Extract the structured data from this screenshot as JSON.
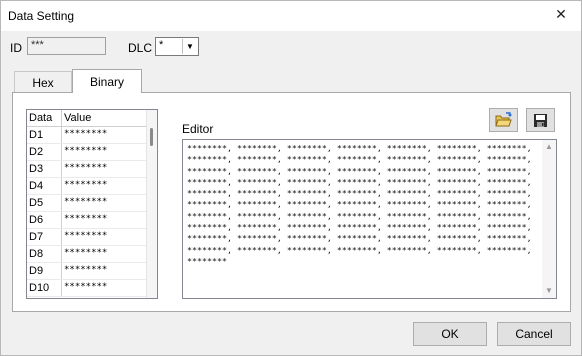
{
  "window": {
    "title": "Data Setting",
    "close_glyph": "✕"
  },
  "id_field": {
    "label": "ID",
    "value": "***"
  },
  "dlc_field": {
    "label": "DLC",
    "value": "*",
    "arrow": "▼"
  },
  "tabs": [
    {
      "label": "Hex"
    },
    {
      "label": "Binary"
    }
  ],
  "data_list": {
    "headers": [
      "Data",
      "Value"
    ],
    "rows": [
      {
        "data": "D1",
        "value": "********"
      },
      {
        "data": "D2",
        "value": "********"
      },
      {
        "data": "D3",
        "value": "********"
      },
      {
        "data": "D4",
        "value": "********"
      },
      {
        "data": "D5",
        "value": "********"
      },
      {
        "data": "D6",
        "value": "********"
      },
      {
        "data": "D7",
        "value": "********"
      },
      {
        "data": "D8",
        "value": "********"
      },
      {
        "data": "D9",
        "value": "********"
      },
      {
        "data": "D10",
        "value": "********"
      }
    ]
  },
  "editor": {
    "label": "Editor",
    "content": "********, ********, ********, ********, ********, ********, ********, ********, ********, ********, ********, ********, ********, ********, ********, ********, ********, ********, ********, ********, ********, ********, ********, ********, ********, ********, ********, ********, ********, ********, ********, ********, ********, ********, ********, ********, ********, ********, ********, ********, ********, ********, ********, ********, ********, ********, ********, ********, ********, ********, ********, ********, ********, ********, ********, ********, ********, ********, ********, ********, ********, ********, ********, ********, ********, ********, ********, ********, ********, ********, ********"
  },
  "icons": {
    "open": "open-folder-icon",
    "save": "save-disk-icon"
  },
  "buttons": {
    "ok": "OK",
    "cancel": "Cancel"
  }
}
